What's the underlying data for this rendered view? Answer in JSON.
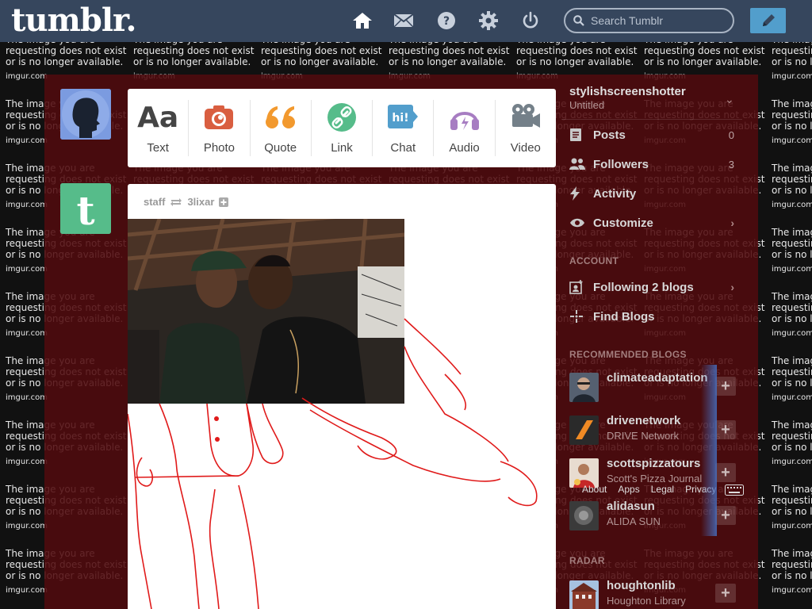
{
  "header": {
    "logo": "tumblr.",
    "search_placeholder": "Search Tumblr",
    "icons": [
      "home-icon",
      "mail-icon",
      "help-icon",
      "gear-icon",
      "power-icon",
      "pencil-icon"
    ]
  },
  "background_tile": {
    "message_line1": "The image you are",
    "message_line2": "requesting does not exist",
    "message_line3": "or is no longer available.",
    "source": "imgur.com"
  },
  "post_types": [
    {
      "label": "Text",
      "icon": "text-icon",
      "color": "#444444"
    },
    {
      "label": "Photo",
      "icon": "camera-icon",
      "color": "#d95e40"
    },
    {
      "label": "Quote",
      "icon": "quote-icon",
      "color": "#f2992e"
    },
    {
      "label": "Link",
      "icon": "link-icon",
      "color": "#56bc8a"
    },
    {
      "label": "Chat",
      "icon": "chat-icon",
      "color": "#529ecc"
    },
    {
      "label": "Audio",
      "icon": "headphones-icon",
      "color": "#a77dc2"
    },
    {
      "label": "Video",
      "icon": "video-camera-icon",
      "color": "#748089"
    }
  ],
  "post": {
    "author": "staff",
    "reblogged_from": "3lixar"
  },
  "sidebar": {
    "blog_name": "stylishscreenshotter",
    "blog_sub": "Untitled",
    "rows": [
      {
        "label": "Posts",
        "count": "0"
      },
      {
        "label": "Followers",
        "count": "3"
      },
      {
        "label": "Activity",
        "count": ""
      },
      {
        "label": "Customize",
        "count": ""
      }
    ],
    "account_heading": "ACCOUNT",
    "account_rows": [
      {
        "label": "Following 2 blogs"
      },
      {
        "label": "Find Blogs"
      }
    ],
    "recommended_heading": "RECOMMENDED BLOGS",
    "recommended": [
      {
        "name": "climateadaptation",
        "sub": ""
      },
      {
        "name": "drivenetwork",
        "sub": "DRIVE Network"
      },
      {
        "name": "scottspizzatours",
        "sub": "Scott's Pizza Journal"
      },
      {
        "name": "alidasun",
        "sub": "ALIDA SUN"
      }
    ],
    "radar_heading": "RADAR",
    "radar": {
      "name": "houghtonlib",
      "sub": "Houghton Library"
    },
    "footer_links": [
      "About",
      "Apps",
      "Legal",
      "Privacy"
    ]
  },
  "colors": {
    "header_bg": "#36465d",
    "compose_bg": "#529ecc",
    "dashboard_tint": "#500a0e"
  }
}
